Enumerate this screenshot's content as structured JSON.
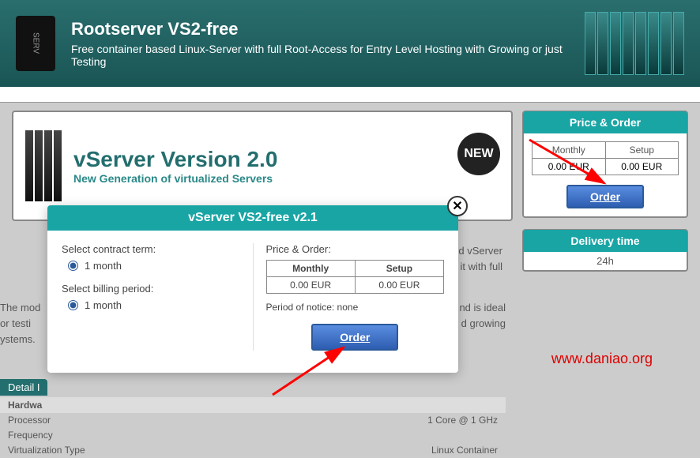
{
  "header": {
    "title": "Rootserver VS2-free",
    "subtitle": "Free container based Linux-Server with full Root-Access for Entry Level Hosting with Growing or just Testing"
  },
  "banner": {
    "title": "vServer Version 2.0",
    "subtitle": "New Generation of virtualized Servers",
    "badge": "NEW"
  },
  "sidebar_price": {
    "heading": "Price & Order",
    "monthly_label": "Monthly",
    "setup_label": "Setup",
    "monthly_value": "0.00 EUR",
    "setup_value": "0.00 EUR",
    "order_button": "Order"
  },
  "delivery": {
    "heading": "Delivery time",
    "value": "24h"
  },
  "description": {
    "line1_right": "id vServer",
    "line2_right": "it with full",
    "line3_left": "The mod",
    "line3_right": "nd is ideal",
    "line4_left": "or testi",
    "line4_right": "d growing",
    "line5_left": "ystems."
  },
  "detail_section": {
    "heading": "Detail I",
    "hardware_label": "Hardwa",
    "rows": [
      {
        "label": "Processor",
        "value": "1 Core @ 1 GHz"
      },
      {
        "label": "Frequency",
        "value": ""
      },
      {
        "label": "Virtualization Type",
        "value": "Linux Container"
      }
    ]
  },
  "modal": {
    "title": "vServer VS2-free v2.1",
    "contract_label": "Select contract term:",
    "contract_option": "1 month",
    "billing_label": "Select billing period:",
    "billing_option": "1 month",
    "price_heading": "Price & Order:",
    "monthly_label": "Monthly",
    "setup_label": "Setup",
    "monthly_value": "0.00 EUR",
    "setup_value": "0.00 EUR",
    "notice": "Period of notice: none",
    "order_button": "Order"
  },
  "watermark": "www.daniao.org"
}
